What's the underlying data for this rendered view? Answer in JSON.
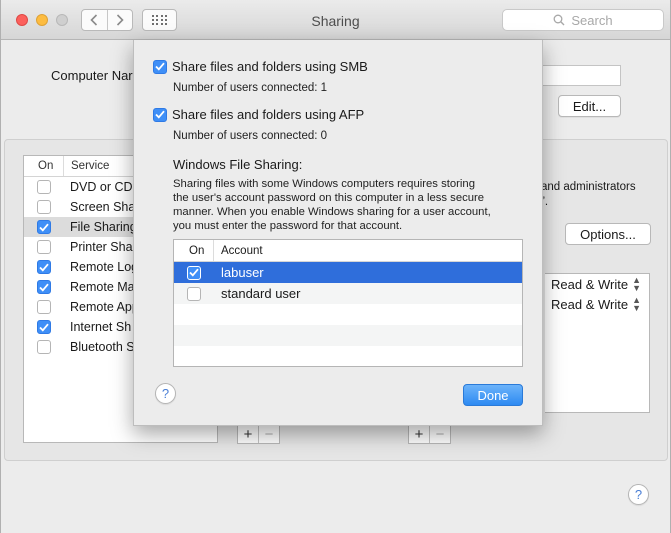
{
  "window": {
    "title": "Sharing",
    "search_placeholder": "Search"
  },
  "main": {
    "computer_name_label": "Computer Nar",
    "edit_button": "Edit...",
    "services_header": {
      "on": "On",
      "service": "Service"
    },
    "services": [
      {
        "label": "DVD or CD",
        "checked": false
      },
      {
        "label": "Screen Sha",
        "checked": false
      },
      {
        "label": "File Sharing",
        "checked": true,
        "selected": true
      },
      {
        "label": "Printer Sha",
        "checked": false
      },
      {
        "label": "Remote Log",
        "checked": true
      },
      {
        "label": "Remote Ma",
        "checked": true
      },
      {
        "label": "Remote App",
        "checked": false
      },
      {
        "label": "Internet Sh",
        "checked": true
      },
      {
        "label": "Bluetooth S",
        "checked": false
      }
    ],
    "right_desc_line1": "and administrators",
    "right_desc_line2": "”.",
    "options_button": "Options...",
    "permissions": [
      "Read & Write",
      "Read & Write"
    ],
    "plus": "+",
    "minus": "−"
  },
  "sheet": {
    "smb_label": "Share files and folders using SMB",
    "smb_checked": true,
    "smb_users": "Number of users connected: 1",
    "afp_label": "Share files and folders using AFP",
    "afp_checked": true,
    "afp_users": "Number of users connected: 0",
    "wfs_heading": "Windows File Sharing:",
    "wfs_desc": [
      "Sharing files with some Windows computers requires storing",
      "the user's account password on this computer in a less secure",
      "manner.  When you enable Windows sharing for a user account,",
      "you must enter the password for that account."
    ],
    "accounts_header": {
      "on": "On",
      "account": "Account"
    },
    "accounts": [
      {
        "name": "labuser",
        "checked": true,
        "selected": true
      },
      {
        "name": "standard user",
        "checked": false
      }
    ],
    "help": "?",
    "done_button": "Done"
  },
  "help_main": "?",
  "colors": {
    "accent": "#3f8ff7",
    "selection": "#2f6edb",
    "close": "#fc605c",
    "minimize": "#fdbc40"
  }
}
